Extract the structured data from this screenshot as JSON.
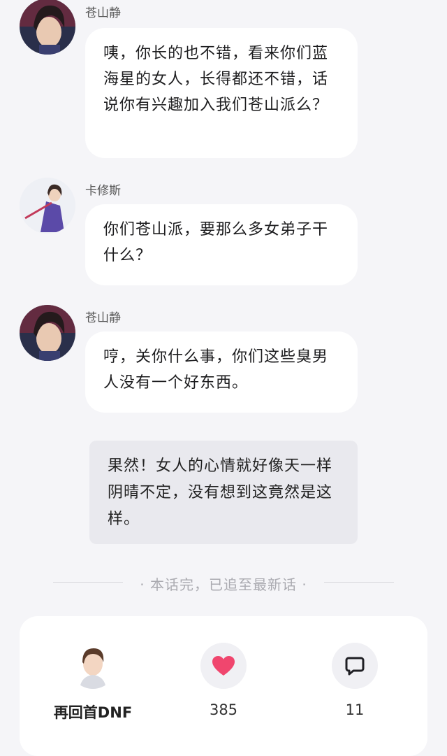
{
  "messages": [
    {
      "speaker": "苍山静",
      "text": "咦，你长的也不错，看来你们蓝海星的女人，长得都还不错，话说你有兴趣加入我们苍山派么？"
    },
    {
      "speaker": "卡修斯",
      "text": "你们苍山派，要那么多女弟子干什么？"
    },
    {
      "speaker": "苍山静",
      "text": "哼，关你什么事，你们这些臭男人没有一个好东西。"
    }
  ],
  "narration": "果然！女人的心情就好像天一样阴晴不定，没有想到这竟然是这样。",
  "chapter_end_text": "· 本话完，已追至最新话 ·",
  "footer": {
    "author_name": "再回首DNF",
    "like_count": "385",
    "comment_count": "11",
    "like_color": "#f0466e",
    "icons": {
      "like": "heart-icon",
      "comment": "comment-icon"
    }
  }
}
